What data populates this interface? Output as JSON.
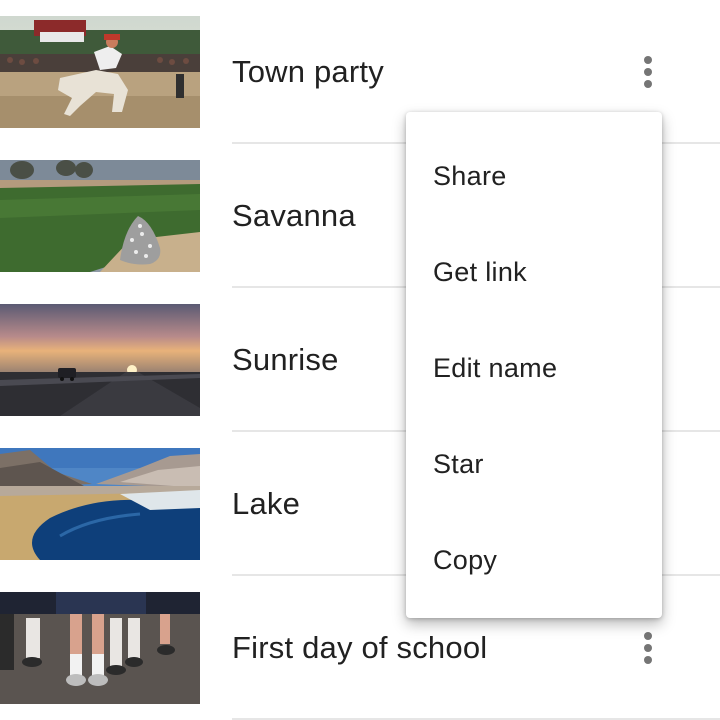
{
  "list": {
    "items": [
      {
        "title": "Town party",
        "thumbnail": "horse-rider-photo",
        "has_more_button": true
      },
      {
        "title": "Savanna",
        "thumbnail": "grassland-photo",
        "has_more_button": false
      },
      {
        "title": "Sunrise",
        "thumbnail": "road-sunrise-photo",
        "has_more_button": false
      },
      {
        "title": "Lake",
        "thumbnail": "mountain-lake-photo",
        "has_more_button": false
      },
      {
        "title": "First day of school",
        "thumbnail": "school-children-photo",
        "has_more_button": true
      }
    ]
  },
  "menu": {
    "items": [
      {
        "label": "Share"
      },
      {
        "label": "Get link"
      },
      {
        "label": "Edit name"
      },
      {
        "label": "Star"
      },
      {
        "label": "Copy"
      }
    ]
  },
  "icons": {
    "more": "more-vert-icon"
  },
  "colors": {
    "text": "#212121",
    "icon": "#757575",
    "divider": "#e6e6e6",
    "menu_background": "#ffffff"
  }
}
